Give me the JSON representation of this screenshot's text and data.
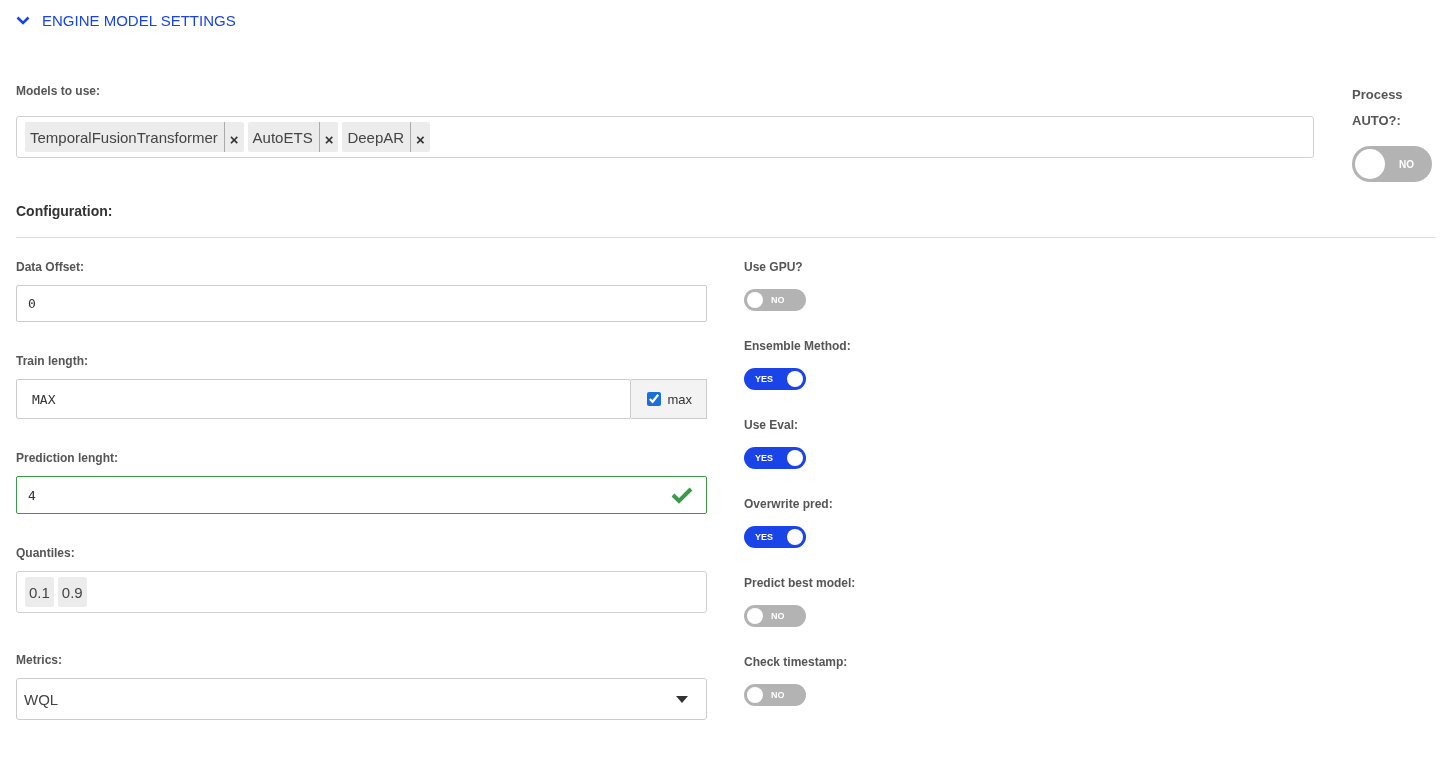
{
  "section": {
    "title": "ENGINE MODEL SETTINGS",
    "expanded": true
  },
  "models": {
    "label": "Models to use:",
    "tags": [
      "TemporalFusionTransformer",
      "AutoETS",
      "DeepAR"
    ],
    "remove_symbol": "×"
  },
  "process_auto": {
    "label": "Process AUTO?:",
    "on": false,
    "text": "NO"
  },
  "configuration": {
    "title": "Configuration:"
  },
  "fields": [
    {
      "kind": "text",
      "label": "Data Offset:",
      "value": "0"
    },
    {
      "kind": "checkbox_input",
      "label": "Train length:",
      "value": "MAX",
      "checkbox_label": "max",
      "checked": true
    },
    {
      "kind": "valid",
      "label": "Prediction lenght:",
      "value": "4",
      "valid": true
    },
    {
      "kind": "tags",
      "label": "Quantiles:",
      "tags": [
        "0.1",
        "0.9"
      ]
    },
    {
      "kind": "select",
      "label": "Metrics:",
      "value": "WQL"
    }
  ],
  "toggles": [
    {
      "label": "Use GPU?",
      "on": false,
      "text": "NO"
    },
    {
      "label": "Ensemble Method:",
      "on": true,
      "text": "YES"
    },
    {
      "label": "Use Eval:",
      "on": true,
      "text": "YES"
    },
    {
      "label": "Overwrite pred:",
      "on": true,
      "text": "YES"
    },
    {
      "label": "Predict best model:",
      "on": false,
      "text": "NO"
    },
    {
      "label": "Check timestamp:",
      "on": false,
      "text": "NO"
    }
  ]
}
